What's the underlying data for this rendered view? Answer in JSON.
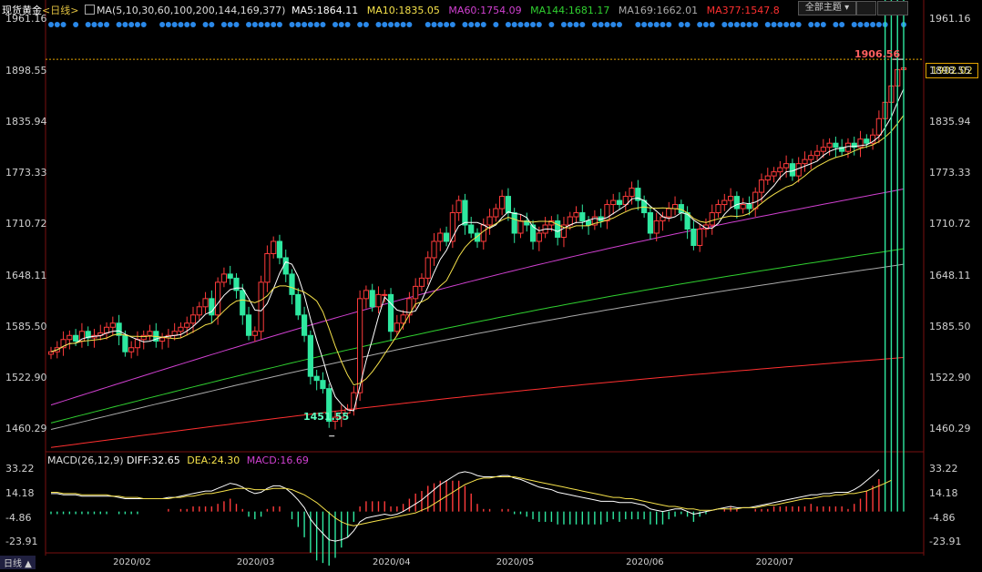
{
  "header": {
    "instrument": "现货黄金",
    "period": "<日线>",
    "ma_params": "MA(5,10,30,60,100,200,144,169,377)",
    "ma5": "MA5:1864.11",
    "ma10": "MA10:1835.05",
    "ma60": "MA60:1754.09",
    "ma144": "MA144:1681.17",
    "ma169": "MA169:1662.01",
    "ma377": "MA377:1547.8",
    "theme_button": "全部主题",
    "theme_icon": "chevron-down-icon"
  },
  "macd_header": {
    "params": "MACD(26,12,9)",
    "diff": "DIFF:32.65",
    "dea": "DEA:24.30",
    "macd": "MACD:16.69"
  },
  "footer": {
    "period_tab": "日线 ▲"
  },
  "last_price": "1902.02",
  "high_label": "1906.56",
  "low_label": "1451.55",
  "colors": {
    "up": "#ff3b3b",
    "down": "#2ee8a0",
    "ma5": "#ffffff",
    "ma10": "#f5e14a",
    "ma60": "#d040d0",
    "ma144": "#30d030",
    "ma169": "#aaaaaa",
    "ma377": "#ff3030",
    "dots": "#2a88e8"
  },
  "chart_data": {
    "type": "candlestick",
    "price_ticks": [
      "1961.16",
      "1898.55",
      "1835.94",
      "1773.33",
      "1710.72",
      "1648.11",
      "1585.50",
      "1522.90",
      "1460.29"
    ],
    "price_ylim": [
      1435,
      1965
    ],
    "macd_ticks": [
      "33.22",
      "14.18",
      "-4.86",
      "-23.91"
    ],
    "macd_ylim": [
      -30,
      38
    ],
    "x_labels": [
      {
        "label": "2020/02",
        "idx": 13
      },
      {
        "label": "2020/03",
        "idx": 33
      },
      {
        "label": "2020/04",
        "idx": 55
      },
      {
        "label": "2020/05",
        "idx": 75
      },
      {
        "label": "2020/06",
        "idx": 96
      },
      {
        "label": "2020/07",
        "idx": 117
      }
    ],
    "closes": [
      1555,
      1560,
      1570,
      1575,
      1568,
      1580,
      1572,
      1575,
      1578,
      1585,
      1590,
      1575,
      1555,
      1560,
      1570,
      1575,
      1580,
      1568,
      1572,
      1575,
      1580,
      1585,
      1590,
      1600,
      1610,
      1620,
      1600,
      1640,
      1650,
      1645,
      1630,
      1600,
      1575,
      1580,
      1640,
      1675,
      1690,
      1670,
      1650,
      1625,
      1600,
      1575,
      1525,
      1520,
      1510,
      1470,
      1475,
      1480,
      1485,
      1505,
      1620,
      1630,
      1610,
      1625,
      1625,
      1580,
      1590,
      1600,
      1620,
      1635,
      1645,
      1670,
      1690,
      1700,
      1690,
      1725,
      1740,
      1710,
      1700,
      1690,
      1710,
      1720,
      1730,
      1745,
      1725,
      1700,
      1715,
      1710,
      1690,
      1700,
      1710,
      1715,
      1695,
      1710,
      1720,
      1725,
      1715,
      1710,
      1720,
      1715,
      1735,
      1740,
      1735,
      1745,
      1755,
      1740,
      1725,
      1700,
      1715,
      1720,
      1730,
      1735,
      1725,
      1705,
      1685,
      1705,
      1710,
      1725,
      1735,
      1740,
      1745,
      1730,
      1735,
      1730,
      1750,
      1765,
      1770,
      1775,
      1780,
      1785,
      1770,
      1785,
      1790,
      1795,
      1800,
      1805,
      1810,
      1805,
      1800,
      1810,
      1805,
      1815,
      1810,
      1820,
      1840,
      1860,
      1880,
      1900,
      1902
    ],
    "ma_series": [
      {
        "key": "ma60",
        "from": 0,
        "to": 138,
        "start": 1490,
        "end": 1754
      },
      {
        "key": "ma144",
        "from": 0,
        "to": 138,
        "start": 1468,
        "end": 1681
      },
      {
        "key": "ma169",
        "from": 0,
        "to": 138,
        "start": 1460,
        "end": 1662
      },
      {
        "key": "ma377",
        "from": 0,
        "to": 138,
        "start": 1438,
        "end": 1548
      }
    ],
    "macd_diff": [
      14,
      14,
      13,
      13,
      13,
      12,
      12,
      12,
      12,
      12,
      12,
      11,
      10,
      10,
      10,
      10,
      10,
      10,
      10,
      11,
      11,
      12,
      13,
      14,
      15,
      16,
      16,
      18,
      20,
      22,
      21,
      19,
      16,
      14,
      15,
      18,
      20,
      20,
      18,
      14,
      9,
      3,
      -6,
      -12,
      -17,
      -22,
      -23,
      -22,
      -20,
      -15,
      -8,
      -5,
      -4,
      -3,
      -2,
      -3,
      -2,
      0,
      3,
      6,
      9,
      13,
      17,
      21,
      24,
      27,
      30,
      31,
      30,
      28,
      27,
      27,
      27,
      28,
      28,
      26,
      25,
      23,
      21,
      19,
      18,
      17,
      15,
      14,
      13,
      12,
      11,
      10,
      9,
      8,
      8,
      8,
      7,
      7,
      7,
      6,
      5,
      2,
      1,
      0,
      1,
      2,
      2,
      0,
      -2,
      -1,
      0,
      1,
      2,
      3,
      4,
      3,
      3,
      3,
      4,
      5,
      6,
      7,
      8,
      9,
      10,
      11,
      12,
      13,
      13,
      14,
      14,
      15,
      15,
      15,
      17,
      20,
      24,
      28,
      32.65
    ],
    "macd_dea": [
      15,
      15,
      14,
      14,
      14,
      13,
      13,
      13,
      13,
      13,
      12,
      12,
      11,
      11,
      11,
      10,
      10,
      10,
      10,
      10,
      11,
      11,
      12,
      12,
      13,
      14,
      14,
      15,
      16,
      17,
      18,
      18,
      18,
      17,
      17,
      17,
      18,
      18,
      18,
      17,
      15,
      13,
      10,
      7,
      3,
      -1,
      -5,
      -8,
      -10,
      -11,
      -10,
      -9,
      -8,
      -7,
      -6,
      -5,
      -4,
      -3,
      -2,
      -1,
      1,
      3,
      6,
      9,
      12,
      15,
      18,
      21,
      23,
      25,
      26,
      26,
      27,
      27,
      27,
      27,
      26,
      25,
      24,
      23,
      22,
      21,
      20,
      19,
      18,
      17,
      16,
      15,
      14,
      13,
      12,
      11,
      11,
      10,
      10,
      9,
      8,
      7,
      6,
      5,
      4,
      4,
      3,
      2,
      2,
      1,
      1,
      1,
      2,
      2,
      2,
      2,
      3,
      3,
      3,
      4,
      5,
      5,
      6,
      7,
      8,
      9,
      10,
      10,
      11,
      12,
      12,
      13,
      13,
      14,
      14,
      15,
      16,
      18,
      20,
      22,
      24.3
    ],
    "dots_row": "dots"
  }
}
